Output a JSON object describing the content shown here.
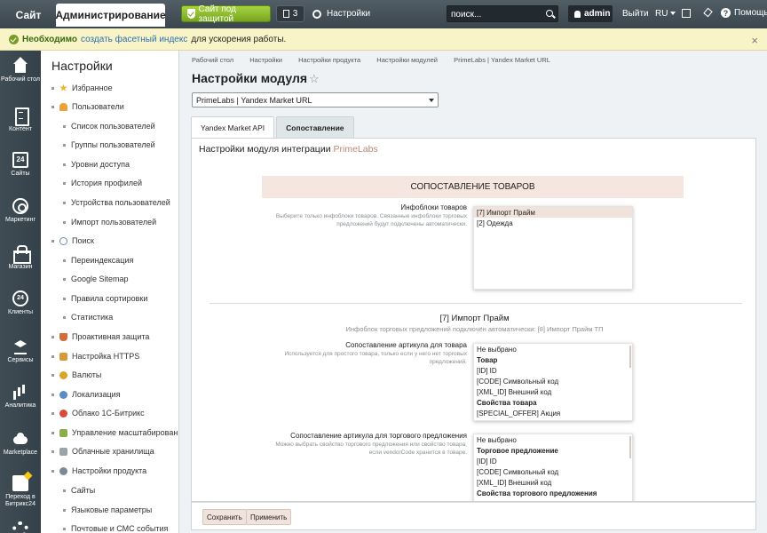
{
  "topbar": {
    "site_tab": "Сайт",
    "admin_tab": "Администрирование",
    "protect_label": "Сайт под защитой",
    "updates_count": "3",
    "settings_label": "Настройки",
    "search_placeholder": "поиск...",
    "user_name": "admin",
    "logout_label": "Выйти",
    "lang_label": "RU",
    "help_label": "Помощь"
  },
  "notice": {
    "required": "Необходимо",
    "link": "создать фасетный индекс",
    "rest": "для ускорения работы."
  },
  "rail": [
    {
      "label": "Рабочий стол",
      "icon": "home-icon"
    },
    {
      "label": "Контент",
      "icon": "document-icon"
    },
    {
      "label": "Сайты",
      "icon": "calendar-icon",
      "glyph": "24"
    },
    {
      "label": "Маркетинг",
      "icon": "target-icon"
    },
    {
      "label": "Магазин",
      "icon": "basket-icon"
    },
    {
      "label": "Клиенты",
      "icon": "clients-icon",
      "glyph": "24"
    },
    {
      "label": "Сервисы",
      "icon": "layers-icon"
    },
    {
      "label": "Аналитика",
      "icon": "bar-chart-icon"
    },
    {
      "label": "Marketplace",
      "icon": "cloud-download-icon"
    },
    {
      "label": "Переход в Битрикс24",
      "icon": "bitrix24-icon"
    },
    {
      "label": "",
      "icon": "settings-gear-icon"
    }
  ],
  "tree": {
    "title": "Настройки",
    "items": [
      {
        "label": "Избранное",
        "level": 0,
        "icon": "star-icon"
      },
      {
        "label": "Пользователи",
        "level": 0,
        "icon": "users-icon"
      },
      {
        "label": "Список пользователей",
        "level": 1
      },
      {
        "label": "Группы пользователей",
        "level": 1
      },
      {
        "label": "Уровни доступа",
        "level": 1
      },
      {
        "label": "История профилей",
        "level": 1
      },
      {
        "label": "Устройства пользователей",
        "level": 1
      },
      {
        "label": "Импорт пользователей",
        "level": 1
      },
      {
        "label": "Поиск",
        "level": 0,
        "icon": "search-icon"
      },
      {
        "label": "Переиндексация",
        "level": 1
      },
      {
        "label": "Google Sitemap",
        "level": 1
      },
      {
        "label": "Правила сортировки",
        "level": 1
      },
      {
        "label": "Статистика",
        "level": 1
      },
      {
        "label": "Проактивная защита",
        "level": 0,
        "icon": "shield-icon"
      },
      {
        "label": "Настройка HTTPS",
        "level": 0,
        "icon": "lock-icon"
      },
      {
        "label": "Валюты",
        "level": 0,
        "icon": "coin-icon"
      },
      {
        "label": "Локализация",
        "level": 0,
        "icon": "globe-icon"
      },
      {
        "label": "Облако 1С-Битрикс",
        "level": 0,
        "icon": "cloud-icon"
      },
      {
        "label": "Управление масштабированием",
        "level": 0,
        "icon": "scale-icon"
      },
      {
        "label": "Облачные хранилища",
        "level": 0,
        "icon": "storage-icon"
      },
      {
        "label": "Настройки продукта",
        "level": 0,
        "icon": "gear-icon"
      },
      {
        "label": "Сайты",
        "level": 1
      },
      {
        "label": "Языковые параметры",
        "level": 1
      },
      {
        "label": "Почтовые и СМС события",
        "level": 1
      }
    ]
  },
  "main": {
    "breadcrumbs": [
      "Рабочий стол",
      "Настройки",
      "Настройки продукта",
      "Настройки модулей",
      "PrimeLabs | Yandex Market URL"
    ],
    "title": "Настройки модуля",
    "module_select": "PrimeLabs | Yandex Market URL",
    "tabs": [
      "Yandex Market API",
      "Сопоставление"
    ],
    "heading_prefix": "Настройки модуля интеграции",
    "heading_brand": "PrimeLabs",
    "section_title": "СОПОСТАВЛЕНИЕ ТОВАРОВ",
    "iblocks": {
      "label": "Инфоблоки товаров",
      "hint": "Выберите только инфоблоки товаров. Связанные инфоблоки торговых предложений будут подключены автоматически.",
      "options": [
        "[7] Импорт Прайм",
        "[2] Одежда"
      ]
    },
    "sub_title": "[7] Импорт Прайм",
    "sub_hint": "Инфоблок торговых предложений подключён автоматически: [8] Импорт Прайм ТП",
    "article_product": {
      "label": "Сопоставление артикула для товара",
      "hint": "Используется для простого товара, только если у него нет торговых предложений.",
      "options": [
        "Не выбрано",
        "Товар",
        "[ID] ID",
        "[CODE] Символьный код",
        "[XML_ID] Внешний код",
        "Свойства товара",
        "[SPECIAL_OFFER] Акция"
      ]
    },
    "article_offer": {
      "label": "Сопоставление артикула для торгового предложения",
      "hint": "Можно выбрать свойство торгового предложения или свойство товара, если vendorCode хранится в товаре.",
      "options": [
        "Не выбрано",
        "Торговое предложение",
        "[ID] ID",
        "[CODE] Символьный код",
        "[XML_ID] Внешний код",
        "Свойства торгового предложения"
      ]
    },
    "save_label": "Сохранить",
    "apply_label": "Применить"
  }
}
